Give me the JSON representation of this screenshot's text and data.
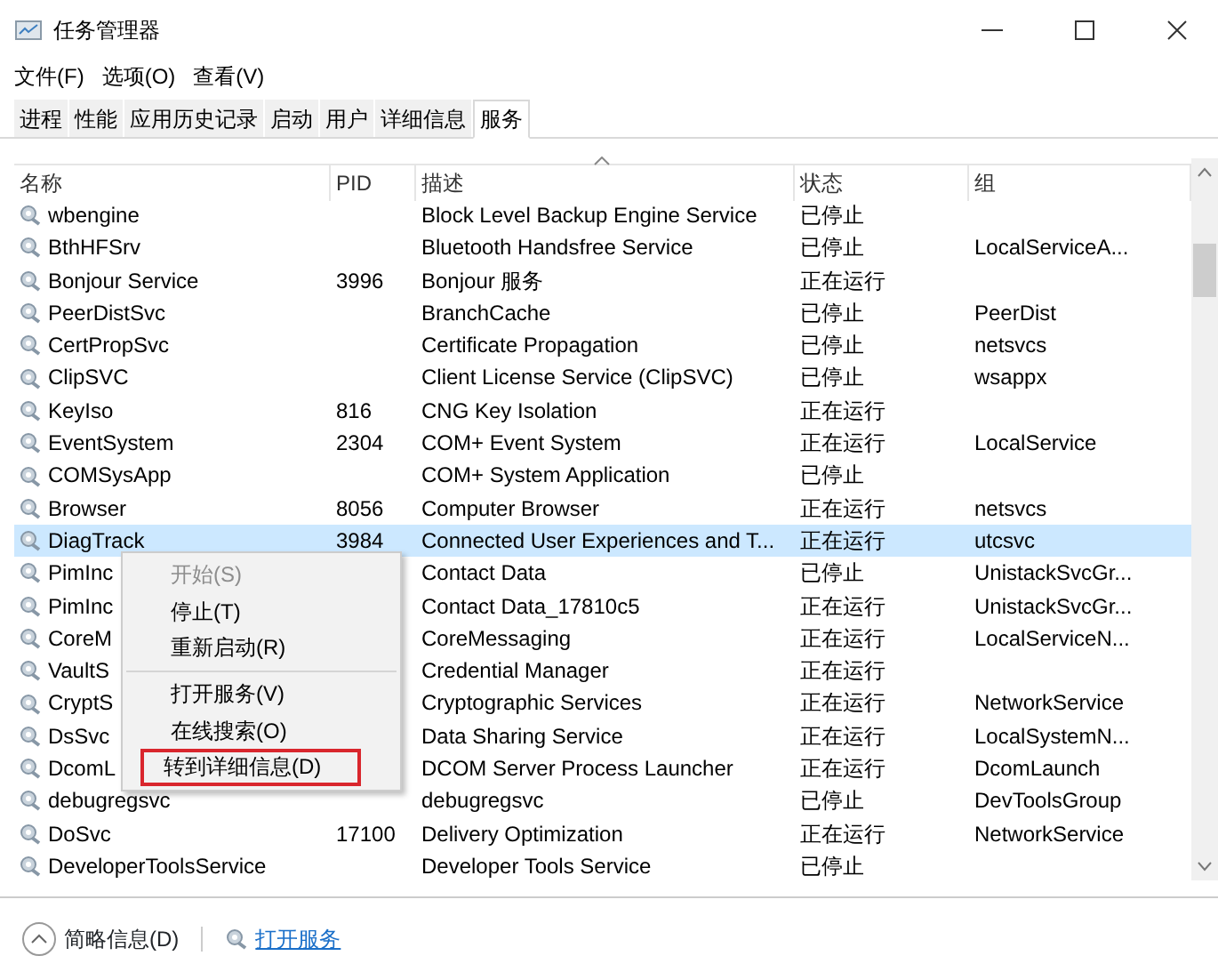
{
  "window": {
    "title": "任务管理器"
  },
  "menu": [
    "文件(F)",
    "选项(O)",
    "查看(V)"
  ],
  "tabs": [
    {
      "label": "进程",
      "selected": false
    },
    {
      "label": "性能",
      "selected": false
    },
    {
      "label": "应用历史记录",
      "selected": false
    },
    {
      "label": "启动",
      "selected": false
    },
    {
      "label": "用户",
      "selected": false
    },
    {
      "label": "详细信息",
      "selected": false
    },
    {
      "label": "服务",
      "selected": true
    }
  ],
  "table": {
    "columns": [
      "名称",
      "PID",
      "描述",
      "状态",
      "组"
    ],
    "rows": [
      {
        "name": "wbengine",
        "pid": "",
        "description": "Block Level Backup Engine Service",
        "status": "已停止",
        "group": "",
        "selected": false
      },
      {
        "name": "BthHFSrv",
        "pid": "",
        "description": "Bluetooth Handsfree Service",
        "status": "已停止",
        "group": "LocalServiceA...",
        "selected": false
      },
      {
        "name": "Bonjour Service",
        "pid": "3996",
        "description": "Bonjour 服务",
        "status": "正在运行",
        "group": "",
        "selected": false
      },
      {
        "name": "PeerDistSvc",
        "pid": "",
        "description": "BranchCache",
        "status": "已停止",
        "group": "PeerDist",
        "selected": false
      },
      {
        "name": "CertPropSvc",
        "pid": "",
        "description": "Certificate Propagation",
        "status": "已停止",
        "group": "netsvcs",
        "selected": false
      },
      {
        "name": "ClipSVC",
        "pid": "",
        "description": "Client License Service (ClipSVC)",
        "status": "已停止",
        "group": "wsappx",
        "selected": false
      },
      {
        "name": "KeyIso",
        "pid": "816",
        "description": "CNG Key Isolation",
        "status": "正在运行",
        "group": "",
        "selected": false
      },
      {
        "name": "EventSystem",
        "pid": "2304",
        "description": "COM+ Event System",
        "status": "正在运行",
        "group": "LocalService",
        "selected": false
      },
      {
        "name": "COMSysApp",
        "pid": "",
        "description": "COM+ System Application",
        "status": "已停止",
        "group": "",
        "selected": false
      },
      {
        "name": "Browser",
        "pid": "8056",
        "description": "Computer Browser",
        "status": "正在运行",
        "group": "netsvcs",
        "selected": false
      },
      {
        "name": "DiagTrack",
        "pid": "3984",
        "description": "Connected User Experiences and T...",
        "status": "正在运行",
        "group": "utcsvc",
        "selected": true
      },
      {
        "name": "PimInc",
        "pid": "",
        "description": "Contact Data",
        "status": "已停止",
        "group": "UnistackSvcGr...",
        "selected": false
      },
      {
        "name": "PimInc",
        "pid": "",
        "description": "Contact Data_17810c5",
        "status": "正在运行",
        "group": "UnistackSvcGr...",
        "selected": false
      },
      {
        "name": "CoreM",
        "pid": "",
        "description": "CoreMessaging",
        "status": "正在运行",
        "group": "LocalServiceN...",
        "selected": false
      },
      {
        "name": "VaultS",
        "pid": "",
        "description": "Credential Manager",
        "status": "正在运行",
        "group": "",
        "selected": false
      },
      {
        "name": "CryptS",
        "pid": "",
        "description": "Cryptographic Services",
        "status": "正在运行",
        "group": "NetworkService",
        "selected": false
      },
      {
        "name": "DsSvc",
        "pid": "",
        "description": "Data Sharing Service",
        "status": "正在运行",
        "group": "LocalSystemN...",
        "selected": false
      },
      {
        "name": "DcomL",
        "pid": "",
        "description": "DCOM Server Process Launcher",
        "status": "正在运行",
        "group": "DcomLaunch",
        "selected": false
      },
      {
        "name": "debugregsvc",
        "pid": "",
        "description": "debugregsvc",
        "status": "已停止",
        "group": "DevToolsGroup",
        "selected": false
      },
      {
        "name": "DoSvc",
        "pid": "17100",
        "description": "Delivery Optimization",
        "status": "正在运行",
        "group": "NetworkService",
        "selected": false
      },
      {
        "name": "DeveloperToolsService",
        "pid": "",
        "description": "Developer Tools Service",
        "status": "已停止",
        "group": "",
        "selected": false
      }
    ]
  },
  "context_menu": [
    {
      "label": "开始(S)",
      "disabled": true,
      "highlighted": false,
      "separator_after": false
    },
    {
      "label": "停止(T)",
      "disabled": false,
      "highlighted": false,
      "separator_after": false
    },
    {
      "label": "重新启动(R)",
      "disabled": false,
      "highlighted": false,
      "separator_after": true
    },
    {
      "label": "打开服务(V)",
      "disabled": false,
      "highlighted": false,
      "separator_after": false
    },
    {
      "label": "在线搜索(O)",
      "disabled": false,
      "highlighted": false,
      "separator_after": false
    },
    {
      "label": "转到详细信息(D)",
      "disabled": false,
      "highlighted": true,
      "separator_after": false
    }
  ],
  "footer": {
    "less_details": "简略信息(D)",
    "open_services": "打开服务"
  }
}
